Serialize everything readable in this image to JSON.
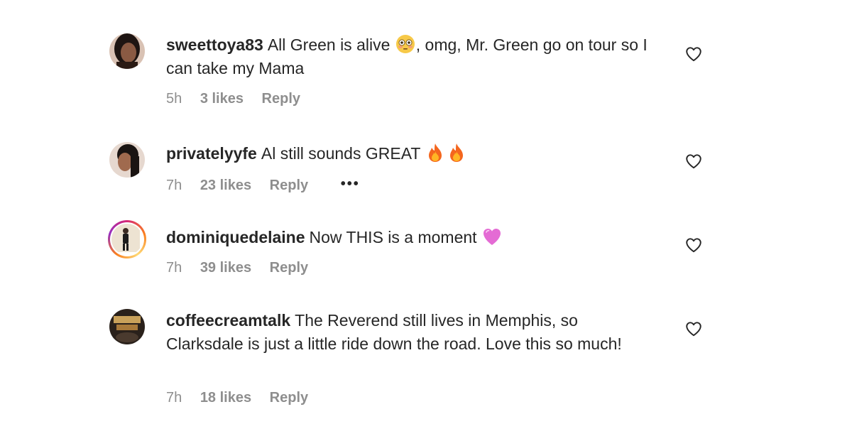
{
  "comments": [
    {
      "username": "sweettoya83",
      "text_before": "All Green is alive",
      "emoji": "flushed-face",
      "text_after": ", omg, Mr. Green go on tour so I can take my Mama",
      "time": "5h",
      "likes": "3 likes",
      "reply": "Reply"
    },
    {
      "username": "privatelyyfe",
      "text": "Al still sounds GREAT",
      "emoji": "fire",
      "time": "7h",
      "likes": "23 likes",
      "reply": "Reply",
      "more": "•••"
    },
    {
      "username": "dominiquedelaine",
      "text": "Now THIS is a moment",
      "emoji": "pink-heart",
      "time": "7h",
      "likes": "39 likes",
      "reply": "Reply"
    },
    {
      "username": "coffeecreamtalk",
      "text": "The Reverend still lives in Memphis, so Clarksdale is just a little ride down the road. Love this so much!",
      "time": "7h",
      "likes": "18 likes",
      "reply": "Reply"
    }
  ]
}
